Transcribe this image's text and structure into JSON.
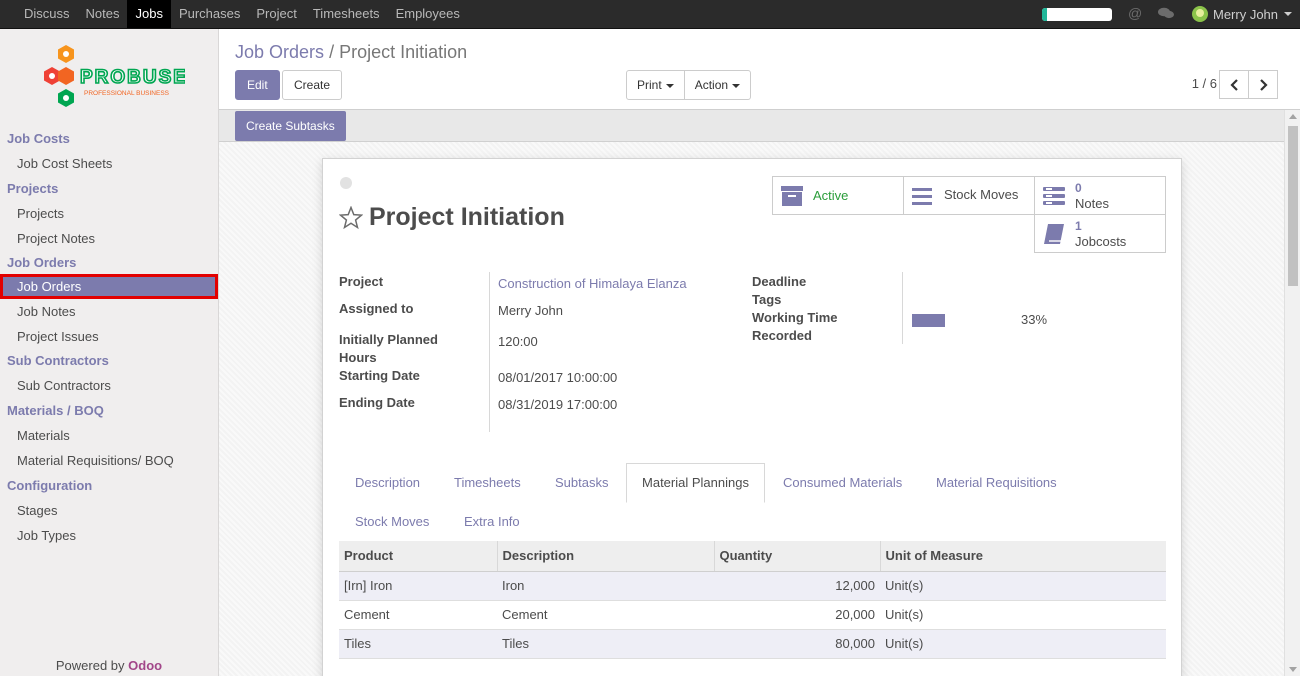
{
  "topbar": {
    "menu": [
      "Discuss",
      "Notes",
      "Jobs",
      "Purchases",
      "Project",
      "Timesheets",
      "Employees"
    ],
    "active_menu": "Jobs",
    "user_name": "Merry John"
  },
  "sidebar": {
    "logo": {
      "brand": "PROBUSE",
      "tagline": "PROFESSIONAL BUSINESS"
    },
    "sections": [
      {
        "title": "Job Costs",
        "items": [
          "Job Cost Sheets"
        ]
      },
      {
        "title": "Projects",
        "items": [
          "Projects",
          "Project Notes"
        ]
      },
      {
        "title": "Job Orders",
        "items": [
          "Job Orders",
          "Job Notes",
          "Project Issues"
        ]
      },
      {
        "title": "Sub Contractors",
        "items": [
          "Sub Contractors"
        ]
      },
      {
        "title": "Materials / BOQ",
        "items": [
          "Materials",
          "Material Requisitions/ BOQ"
        ]
      },
      {
        "title": "Configuration",
        "items": [
          "Stages",
          "Job Types"
        ]
      }
    ],
    "active_item": "Job Orders",
    "powered_by": "Powered by",
    "powered_brand": "Odoo"
  },
  "control": {
    "breadcrumb_parent": "Job Orders",
    "breadcrumb_sep": "/",
    "breadcrumb_current": "Project Initiation",
    "edit_label": "Edit",
    "create_label": "Create",
    "print_label": "Print",
    "action_label": "Action",
    "pager": "1 / 6"
  },
  "statusbar": {
    "create_subtasks_label": "Create Subtasks"
  },
  "form": {
    "title": "Project Initiation",
    "smart_buttons": {
      "active_label": "Active",
      "stock_moves_label": "Stock Moves",
      "notes_count": "0",
      "notes_label": "Notes",
      "jobcosts_count": "1",
      "jobcosts_label": "Jobcosts"
    },
    "left_fields": {
      "project_label": "Project",
      "project_value": "Construction of Himalaya Elanza",
      "assigned_label": "Assigned to",
      "assigned_value": "Merry John",
      "planned_label_1": "Initially Planned",
      "planned_label_2": "Hours",
      "planned_value": "120:00",
      "start_label": "Starting Date",
      "start_value": "08/01/2017 10:00:00",
      "end_label": "Ending Date",
      "end_value": "08/31/2019 17:00:00"
    },
    "right_fields": {
      "deadline_label": "Deadline",
      "tags_label": "Tags",
      "wt_label_1": "Working Time",
      "wt_label_2": "Recorded",
      "wt_percent": "33%",
      "wt_fraction": 0.33
    },
    "tabs": [
      "Description",
      "Timesheets",
      "Subtasks",
      "Material Plannings",
      "Consumed Materials",
      "Material Requisitions",
      "Stock Moves",
      "Extra Info"
    ],
    "active_tab": "Material Plannings",
    "table": {
      "headers": [
        "Product",
        "Description",
        "Quantity",
        "Unit of Measure"
      ],
      "rows": [
        [
          "[Irn] Iron",
          "Iron",
          "12,000",
          "Unit(s)"
        ],
        [
          "Cement",
          "Cement",
          "20,000",
          "Unit(s)"
        ],
        [
          "Tiles",
          "Tiles",
          "80,000",
          "Unit(s)"
        ]
      ]
    }
  },
  "colors": {
    "accent": "#7c7bad",
    "brand_odoo": "#a24689",
    "active_green": "#2a9d3a",
    "highlight": "#e20000"
  }
}
